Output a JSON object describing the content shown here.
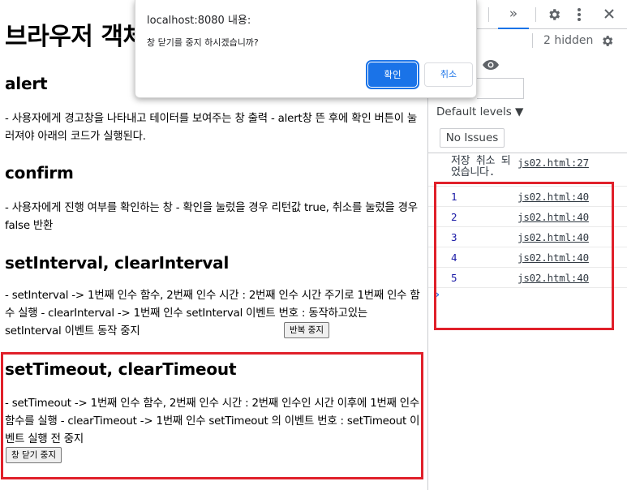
{
  "page": {
    "title": "브라우저 객체",
    "sections": [
      {
        "heading": "alert",
        "body": "- 사용자에게 경고창을 나타내고 테이터를 보여주는 창 출력 - alert창 뜬 후에 확인 버튼이 눌러져야 아래의 코드가 실행된다."
      },
      {
        "heading": "confirm",
        "body": "- 사용자에게 진행 여부를 확인하는 창 - 확인을 눌렀을 경우 리턴값 true, 취소를 눌렀을 경우 false 반환"
      },
      {
        "heading": "setInterval, clearInterval",
        "body": "- setInterval -> 1번째 인수 함수, 2번째 인수 시간 : 2번째 인수 시간 주기로 1번째 인수 함수 실행 - clearInterval -> 1번째 인수 setInterval 이벤트 번호 : 동작하고있는 setInterval 이벤트 동작 중지",
        "button": "반복 중지"
      },
      {
        "heading": "setTimeout, clearTimeout",
        "body": "- setTimeout -> 1번째 인수 함수, 2번째 인수 시간 : 2번째 인수인 시간 이후에 1번째 인수 함수를 실행 - clearTimeout -> 1번째 인수 setTimeout 의 이벤트 번호 : setTimeout 이벤트 실행 전 중지",
        "button": "창 닫기 중지"
      }
    ]
  },
  "dialog": {
    "origin": "localhost:8080 내용:",
    "message": "창 닫기를 중지 하시겠습니까?",
    "ok_label": "확인",
    "cancel_label": "취소"
  },
  "devtools": {
    "more_tabs_icon": "»",
    "hidden_count": "2 hidden",
    "levels_label": "Default levels ▼",
    "issues_label": "No Issues",
    "console": {
      "first_message": "저장 취소 되었습니다.",
      "first_source": "js02.html:27",
      "rows": [
        {
          "value": "1",
          "source": "js02.html:40"
        },
        {
          "value": "2",
          "source": "js02.html:40"
        },
        {
          "value": "3",
          "source": "js02.html:40"
        },
        {
          "value": "4",
          "source": "js02.html:40"
        },
        {
          "value": "5",
          "source": "js02.html:40"
        }
      ],
      "prompt": "›"
    }
  },
  "colors": {
    "highlight": "#e0202a",
    "accent": "#1a73e8"
  }
}
